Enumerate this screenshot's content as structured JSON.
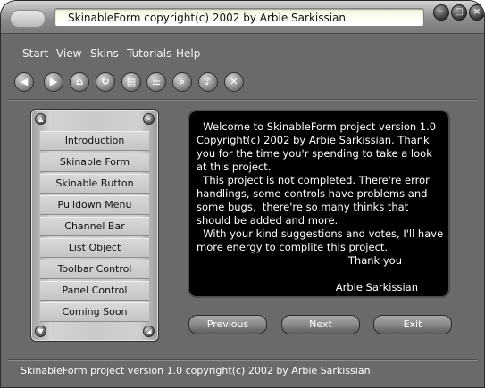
{
  "window": {
    "title": "SkinableForm copyright(c) 2002 by Arbie Sarkissian"
  },
  "menu": {
    "items": [
      "Start",
      "View",
      "Skins",
      "Tutorials",
      "Help"
    ]
  },
  "toolbar": {
    "buttons": [
      {
        "icon": "back-arrow-icon"
      },
      {
        "icon": "forward-arrow-icon"
      },
      {
        "icon": "home-icon"
      },
      {
        "icon": "refresh-icon"
      },
      {
        "icon": "document-icon"
      },
      {
        "icon": "list-document-icon"
      },
      {
        "icon": "search-icon"
      },
      {
        "icon": "music-note-icon"
      },
      {
        "icon": "close-icon"
      }
    ]
  },
  "panel": {
    "items": [
      "Introduction",
      "Skinable Form",
      "Skinable Button",
      "Pulldown Menu",
      "Channel Bar",
      "List Object",
      "Toolbar Control",
      "Panel Control",
      "Coming Soon"
    ]
  },
  "message": {
    "lines": [
      "  Welcome to SkinableForm project version 1.0",
      "Copyright(c) 2002 by Arbie Sarkissian. Thank",
      "you for the time you'r spending to take a look",
      "at this project.",
      "  This project is not completed. There're error",
      "handlings, some controls have problems and",
      "some bugs,  there're so many thinks that",
      "should be added and more.",
      "  With your kind suggestions and votes, I'll have",
      "more energy to complite this project."
    ],
    "thanks": "Thank you",
    "signature": "Arbie Sarkissian"
  },
  "nav": {
    "previous": "Previous",
    "next": "Next",
    "exit": "Exit"
  },
  "status": {
    "text": "SkinableForm project version 1.0 copyright(c) 2002 by Arbie Sarkissian"
  }
}
